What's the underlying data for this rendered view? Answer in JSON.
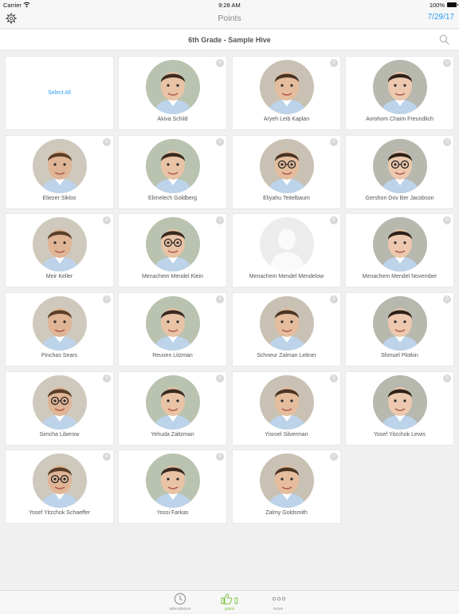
{
  "status_bar": {
    "carrier": "Carrier",
    "time": "9:28 AM",
    "battery": "100%"
  },
  "nav": {
    "title": "Points",
    "date": "7/29/17"
  },
  "header": {
    "hive_name": "6th Grade - Sample Hive"
  },
  "select_all_label": "Select All",
  "students": [
    {
      "name": "Akiva Schild",
      "points": "0",
      "photo": "photo-boy"
    },
    {
      "name": "Aryeh Leib Kaplan",
      "points": "0",
      "photo": "photo-boy"
    },
    {
      "name": "Avrohom Chaim Freundlich",
      "points": "0",
      "photo": "photo-boy"
    },
    {
      "name": "Eliezer Siklos",
      "points": "0",
      "photo": "photo-boy"
    },
    {
      "name": "Elimelech Goldberg",
      "points": "0",
      "photo": "photo-boy"
    },
    {
      "name": "Eliyahu Teitelbaum",
      "points": "0",
      "photo": "photo-boy-glasses"
    },
    {
      "name": "Gershon Dov Ber Jacobson",
      "points": "0",
      "photo": "photo-boy-glasses"
    },
    {
      "name": "Meir Keller",
      "points": "0",
      "photo": "photo-boy"
    },
    {
      "name": "Menachem Mendel Klein",
      "points": "0",
      "photo": "photo-boy-glasses"
    },
    {
      "name": "Menachem Mendel Mendelow",
      "points": "0",
      "photo": "placeholder-avatar"
    },
    {
      "name": "Menachem Mendel November",
      "points": "0",
      "photo": "photo-boy"
    },
    {
      "name": "Pinchas Sears",
      "points": "0",
      "photo": "photo-boy"
    },
    {
      "name": "Reuven Litzman",
      "points": "0",
      "photo": "photo-boy"
    },
    {
      "name": "Schneur Zalman Leitner",
      "points": "0",
      "photo": "photo-boy"
    },
    {
      "name": "Shmuel Plotkin",
      "points": "0",
      "photo": "photo-boy"
    },
    {
      "name": "Simcha Liberow",
      "points": "0",
      "photo": "photo-boy-glasses"
    },
    {
      "name": "Yehuda Zaltzman",
      "points": "0",
      "photo": "photo-boy"
    },
    {
      "name": "Yisroel Silverman",
      "points": "0",
      "photo": "photo-boy"
    },
    {
      "name": "Yosef Yitzchok Lewis",
      "points": "0",
      "photo": "photo-boy"
    },
    {
      "name": "Yosef Yitzchok Schaeffer",
      "points": "0",
      "photo": "photo-boy-glasses"
    },
    {
      "name": "Yossi Farkas",
      "points": "0",
      "photo": "photo-boy"
    },
    {
      "name": "Zalmy Goldsmith",
      "points": "0",
      "photo": "photo-boy"
    }
  ],
  "tabs": [
    {
      "label": "attendance",
      "icon": "clock-icon",
      "active": false
    },
    {
      "label": "point",
      "icon": "thumbs-up-icon",
      "active": true
    },
    {
      "label": "more",
      "icon": "more-dots-icon",
      "active": false
    }
  ],
  "colors": {
    "accent": "#2a9df4",
    "active_tab": "#7cc243",
    "badge": "#d8d8d8"
  }
}
